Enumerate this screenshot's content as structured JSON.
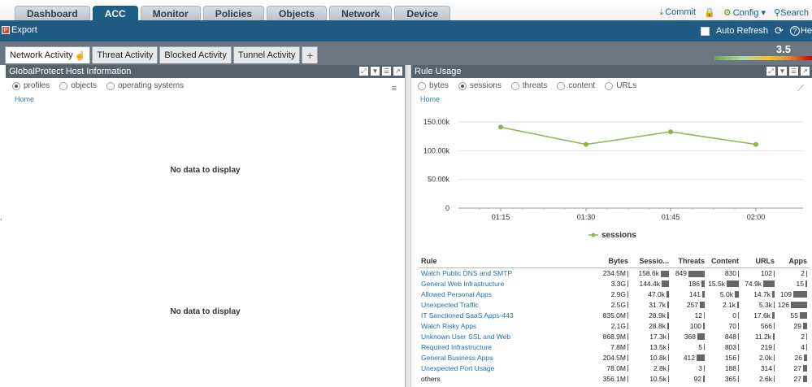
{
  "nav": {
    "tabs": [
      "Dashboard",
      "ACC",
      "Monitor",
      "Policies",
      "Objects",
      "Network",
      "Device"
    ],
    "active": "ACC",
    "commit": "Commit",
    "config": "Config",
    "search": "Search"
  },
  "toolbar": {
    "export": "Export",
    "auto_refresh": "Auto Refresh",
    "help": "He"
  },
  "subtabs": {
    "items": [
      "Network Activity",
      "Threat Activity",
      "Blocked Activity",
      "Tunnel Activity"
    ],
    "plus": "+"
  },
  "risk": {
    "value": "3.5"
  },
  "left_panel": {
    "title": "GlobalProtect Host Information",
    "radios": [
      "profiles",
      "objects",
      "operating systems"
    ],
    "selected": "profiles",
    "home": "Home",
    "empty1": "No data to display",
    "empty2": "No data to display"
  },
  "right_panel": {
    "title": "Rule Usage",
    "radios": [
      "bytes",
      "sessions",
      "threats",
      "content",
      "URLs"
    ],
    "selected": "sessions",
    "home": "Home"
  },
  "chart_data": {
    "type": "line",
    "x": [
      "01:15",
      "01:30",
      "01:45",
      "02:00"
    ],
    "series": [
      {
        "name": "sessions",
        "values": [
          141000,
          111000,
          133000,
          111000
        ],
        "color": "#8db646"
      }
    ],
    "yticks": [
      "150.00k",
      "100.00k",
      "50.00k",
      "0"
    ],
    "ylim": [
      0,
      160000
    ],
    "grid": true,
    "legend": "bottom"
  },
  "table": {
    "headers": [
      "Rule",
      "Bytes",
      "Sessio...",
      "Threats",
      "Content",
      "URLs",
      "Apps"
    ],
    "rows": [
      {
        "rule": "Watch Public DNS and SMTP",
        "bytes": "234.5M",
        "sessions": "158.6k",
        "threats": "849",
        "content": "830",
        "urls": "102",
        "apps": "2",
        "b": 0.05,
        "s": 1.0,
        "t": 1.0,
        "c": 0.05,
        "u": 0.05,
        "a": 0.05
      },
      {
        "rule": "General Web Infrastructure",
        "bytes": "3.3G",
        "sessions": "144.4k",
        "threats": "186",
        "content": "15.5k",
        "urls": "74.9k",
        "apps": "15",
        "b": 0.05,
        "s": 0.9,
        "t": 0.2,
        "c": 1.0,
        "u": 1.0,
        "a": 0.1
      },
      {
        "rule": "Allowed Personal Apps",
        "bytes": "2.9G",
        "sessions": "47.0k",
        "threats": "141",
        "content": "5.0k",
        "urls": "14.7k",
        "apps": "109",
        "b": 0.05,
        "s": 0.3,
        "t": 0.15,
        "c": 0.3,
        "u": 0.2,
        "a": 0.85
      },
      {
        "rule": "Unexpected Traffic",
        "bytes": "2.5G",
        "sessions": "31.7k",
        "threats": "257",
        "content": "2.1k",
        "urls": "5.3k",
        "apps": "126",
        "b": 0.05,
        "s": 0.2,
        "t": 0.3,
        "c": 0.12,
        "u": 0.07,
        "a": 1.0
      },
      {
        "rule": "IT Sanctioned SaaS Apps-443",
        "bytes": "835.0M",
        "sessions": "28.9k",
        "threats": "12",
        "content": "0",
        "urls": "17.6k",
        "apps": "55",
        "b": 0.05,
        "s": 0.18,
        "t": 0.03,
        "c": 0.0,
        "u": 0.23,
        "a": 0.45
      },
      {
        "rule": "Watch Risky Apps",
        "bytes": "2.1G",
        "sessions": "28.8k",
        "threats": "100",
        "content": "70",
        "urls": "566",
        "apps": "29",
        "b": 0.05,
        "s": 0.18,
        "t": 0.12,
        "c": 0.05,
        "u": 0.05,
        "a": 0.25
      },
      {
        "rule": "Unknown User SSL and Web",
        "bytes": "868.9M",
        "sessions": "17.3k",
        "threats": "368",
        "content": "848",
        "urls": "11.2k",
        "apps": "2",
        "b": 0.05,
        "s": 0.12,
        "t": 0.43,
        "c": 0.05,
        "u": 0.15,
        "a": 0.05
      },
      {
        "rule": "Required Infrastructure",
        "bytes": "7.8M",
        "sessions": "13.5k",
        "threats": "5",
        "content": "803",
        "urls": "219",
        "apps": "4",
        "b": 0.05,
        "s": 0.09,
        "t": 0.03,
        "c": 0.05,
        "u": 0.05,
        "a": 0.05
      },
      {
        "rule": "General Business Apps",
        "bytes": "204.5M",
        "sessions": "10.8k",
        "threats": "412",
        "content": "156",
        "urls": "2.0k",
        "apps": "26",
        "b": 0.05,
        "s": 0.07,
        "t": 0.48,
        "c": 0.05,
        "u": 0.05,
        "a": 0.22
      },
      {
        "rule": "Unexpected Port Usage",
        "bytes": "78.0M",
        "sessions": "2.8k",
        "threats": "3",
        "content": "188",
        "urls": "314",
        "apps": "27",
        "b": 0.05,
        "s": 0.03,
        "t": 0.03,
        "c": 0.05,
        "u": 0.05,
        "a": 0.23
      },
      {
        "rule": "others",
        "bytes": "356.1M",
        "sessions": "10.5k",
        "threats": "92",
        "content": "365",
        "urls": "2.6k",
        "apps": "27",
        "b": 0.05,
        "s": 0.07,
        "t": 0.11,
        "c": 0.05,
        "u": 0.05,
        "a": 0.23,
        "plain": true
      }
    ]
  }
}
